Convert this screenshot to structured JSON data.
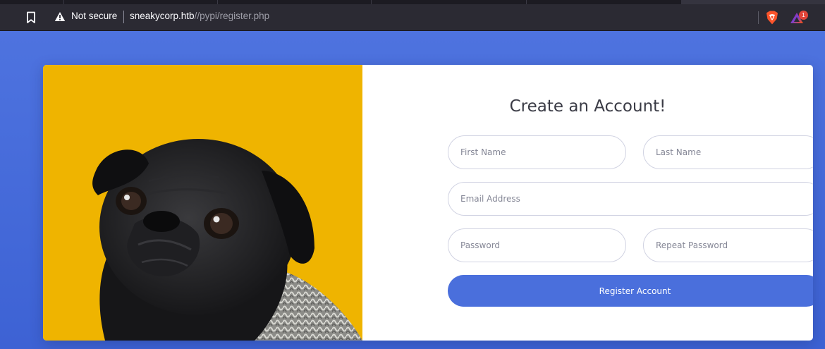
{
  "browser": {
    "security_label": "Not secure",
    "url_host": "sneakycorp.htb",
    "url_path": "//pypi/register.php",
    "rewards_badge_count": "1",
    "icons": [
      "bookmark-icon",
      "warning-icon",
      "brave-shield-icon",
      "brave-rewards-icon"
    ]
  },
  "form": {
    "title": "Create an Account!",
    "first_name_placeholder": "First Name",
    "last_name_placeholder": "Last Name",
    "email_placeholder": "Email Address",
    "password_placeholder": "Password",
    "repeat_password_placeholder": "Repeat Password",
    "submit_label": "Register Account"
  },
  "colors": {
    "primary": "#4e73df",
    "image_background": "#efb400",
    "chrome": "#2b2a33"
  }
}
